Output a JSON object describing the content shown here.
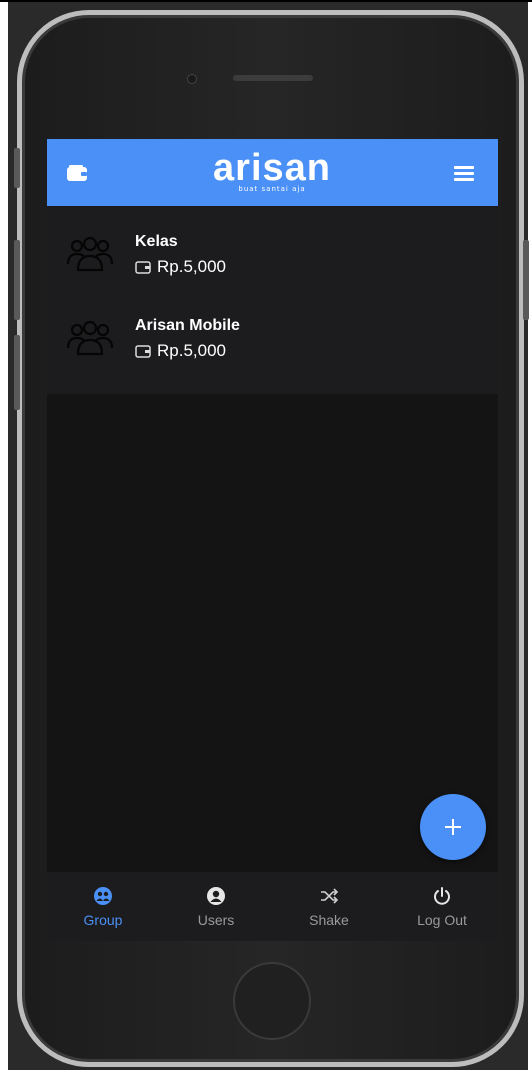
{
  "appbar": {
    "logo": "arisan",
    "tagline": "buat santai aja",
    "wallet_icon": "wallet-icon",
    "menu_icon": "menu-icon",
    "color": "#4a90f7"
  },
  "groups": [
    {
      "name": "Kelas",
      "amount": "Rp.5,000",
      "icon": "group-icon"
    },
    {
      "name": "Arisan Mobile",
      "amount": "Rp.5,000",
      "icon": "group-icon"
    }
  ],
  "fab": {
    "icon": "plus-icon"
  },
  "bottom_nav": {
    "items": [
      {
        "label": "Group",
        "icon": "group-nav-icon",
        "active": true
      },
      {
        "label": "Users",
        "icon": "user-circle-icon",
        "active": false
      },
      {
        "label": "Shake",
        "icon": "shuffle-icon",
        "active": false
      },
      {
        "label": "Log Out",
        "icon": "power-icon",
        "active": false
      }
    ]
  },
  "colors": {
    "accent": "#4a90f7",
    "screen_bg": "#141414",
    "surface": "#1c1c1e"
  }
}
